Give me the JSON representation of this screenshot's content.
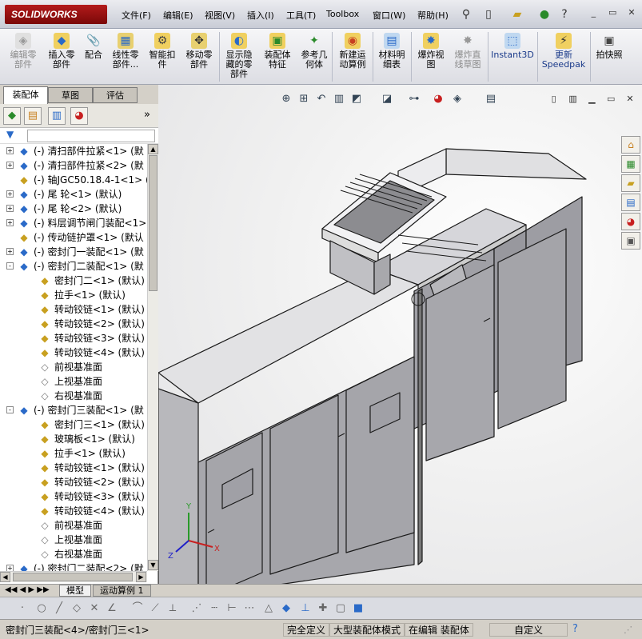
{
  "app": {
    "logo": "SOLIDWORKS"
  },
  "menu": [
    "文件(F)",
    "编辑(E)",
    "视图(V)",
    "插入(I)",
    "工具(T)",
    "Toolbox",
    "窗口(W)",
    "帮助(H)"
  ],
  "ribbon": [
    {
      "label": "编辑零\n部件",
      "disabled": true
    },
    {
      "label": "插入零\n部件",
      "disabled": false
    },
    {
      "label": "配合",
      "disabled": false
    },
    {
      "label": "线性零\n部件...",
      "disabled": false
    },
    {
      "label": "智能扣\n件",
      "disabled": false
    },
    {
      "label": "移动零\n部件",
      "disabled": false
    },
    {
      "label": "显示隐\n藏的零\n部件",
      "disabled": false
    },
    {
      "label": "装配体\n特征",
      "disabled": false
    },
    {
      "label": "参考几\n何体",
      "disabled": false
    },
    {
      "label": "新建运\n动算例",
      "disabled": false
    },
    {
      "label": "材料明\n细表",
      "disabled": false
    },
    {
      "label": "爆炸视\n图",
      "disabled": false
    },
    {
      "label": "爆炸直\n线草图",
      "disabled": true
    },
    {
      "label": "Instant3D",
      "disabled": false
    },
    {
      "label": "更新\nSpeedpak",
      "disabled": false
    },
    {
      "label": "拍快照",
      "disabled": false
    }
  ],
  "panel": {
    "tabs": [
      "装配体",
      "草图",
      "评估"
    ]
  },
  "tree": [
    {
      "label": "(-) 清扫部件拉紧<1> (默",
      "expand": "+",
      "icon": "asm"
    },
    {
      "label": "(-) 清扫部件拉紧<2> (默",
      "expand": "+",
      "icon": "asm"
    },
    {
      "label": "(-) 轴JGC50.18.4-1<1> (",
      "expand": "",
      "icon": "part"
    },
    {
      "label": "(-) 尾 轮<1> (默认)",
      "expand": "+",
      "icon": "asm"
    },
    {
      "label": "(-) 尾 轮<2> (默认)",
      "expand": "+",
      "icon": "asm"
    },
    {
      "label": "(-) 料层调节闸门装配<1>",
      "expand": "+",
      "icon": "asm"
    },
    {
      "label": "(-) 传动链护罩<1> (默认",
      "expand": "",
      "icon": "part"
    },
    {
      "label": "(-) 密封门一装配<1> (默",
      "expand": "+",
      "icon": "asm"
    },
    {
      "label": "(-) 密封门二装配<1> (默",
      "expand": "-",
      "icon": "asm"
    },
    {
      "label": "密封门二<1> (默认)",
      "expand": "",
      "icon": "part",
      "indent": 1
    },
    {
      "label": "拉手<1> (默认)",
      "expand": "",
      "icon": "part",
      "indent": 1
    },
    {
      "label": "转动铰链<1> (默认)",
      "expand": "",
      "icon": "part",
      "indent": 1
    },
    {
      "label": "转动铰链<2> (默认)",
      "expand": "",
      "icon": "part",
      "indent": 1
    },
    {
      "label": "转动铰链<3> (默认)",
      "expand": "",
      "icon": "part",
      "indent": 1
    },
    {
      "label": "转动铰链<4> (默认)",
      "expand": "",
      "icon": "part",
      "indent": 1
    },
    {
      "label": "前视基准面",
      "expand": "",
      "icon": "plane",
      "indent": 1
    },
    {
      "label": "上视基准面",
      "expand": "",
      "icon": "plane",
      "indent": 1
    },
    {
      "label": "右视基准面",
      "expand": "",
      "icon": "plane",
      "indent": 1
    },
    {
      "label": "(-) 密封门三装配<1> (默",
      "expand": "-",
      "icon": "asm"
    },
    {
      "label": "密封门三<1> (默认)",
      "expand": "",
      "icon": "part",
      "indent": 1
    },
    {
      "label": "玻璃板<1> (默认)",
      "expand": "",
      "icon": "part",
      "indent": 1
    },
    {
      "label": "拉手<1> (默认)",
      "expand": "",
      "icon": "part",
      "indent": 1
    },
    {
      "label": "转动铰链<1> (默认)",
      "expand": "",
      "icon": "part",
      "indent": 1
    },
    {
      "label": "转动铰链<2> (默认)",
      "expand": "",
      "icon": "part",
      "indent": 1
    },
    {
      "label": "转动铰链<3> (默认)",
      "expand": "",
      "icon": "part",
      "indent": 1
    },
    {
      "label": "转动铰链<4> (默认)",
      "expand": "",
      "icon": "part",
      "indent": 1
    },
    {
      "label": "前视基准面",
      "expand": "",
      "icon": "plane",
      "indent": 1
    },
    {
      "label": "上视基准面",
      "expand": "",
      "icon": "plane",
      "indent": 1
    },
    {
      "label": "右视基准面",
      "expand": "",
      "icon": "plane",
      "indent": 1
    },
    {
      "label": "(-) 密封门二装配<2> (默",
      "expand": "+",
      "icon": "asm"
    }
  ],
  "bottomTabs": [
    "模型",
    "运动算例 1"
  ],
  "status": {
    "path": "密封门三装配<4>/密封门三<1>",
    "defined": "完全定义",
    "mode": "大型装配体模式",
    "editing": "在编辑 装配体",
    "custom": "自定义"
  }
}
